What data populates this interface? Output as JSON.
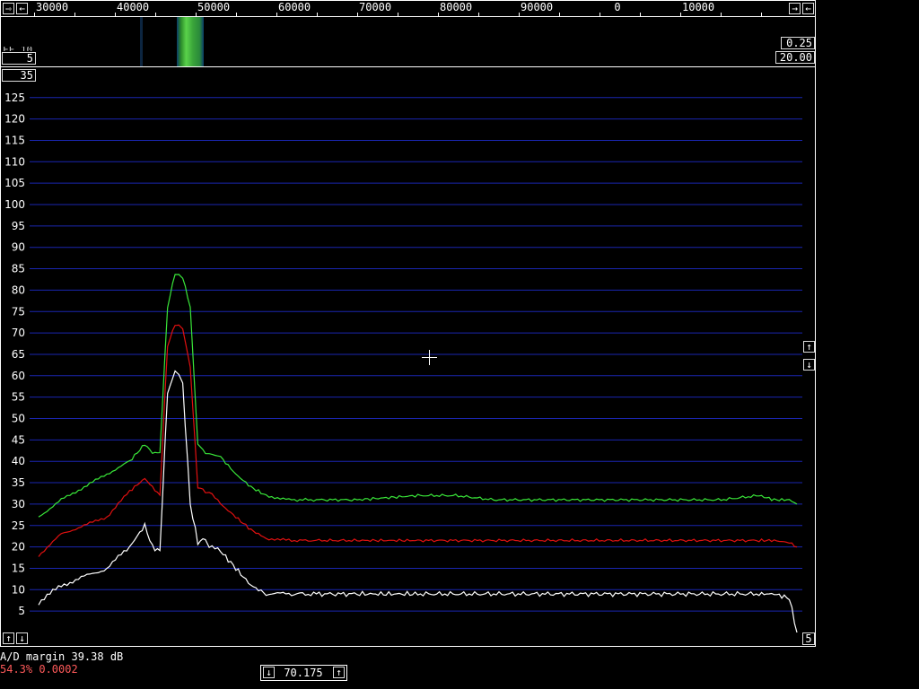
{
  "frequency_scale": {
    "tick_labels": [
      "30000",
      "40000",
      "50000",
      "60000",
      "70000",
      "80000",
      "90000",
      "0",
      "10000"
    ]
  },
  "waterfall": {
    "label_partial": "FF 10",
    "left_box_value": "5",
    "right_top_value": "0.25",
    "right_bottom_value": "20.00"
  },
  "spectrum": {
    "top_left_box_value": "35",
    "bottom_right_box_value": "5",
    "y_tick_labels": [
      "125",
      "120",
      "115",
      "110",
      "105",
      "100",
      "95",
      "90",
      "85",
      "80",
      "75",
      "70",
      "65",
      "60",
      "55",
      "50",
      "45",
      "40",
      "35",
      "30",
      "25",
      "20",
      "15",
      "10",
      "5"
    ]
  },
  "status": {
    "ad_margin_text": "A/D margin 39.38 dB",
    "load_text": "54.3% 0.0002",
    "load_color": "#ff5a5a"
  },
  "freq_control": {
    "value": "70.175"
  },
  "chart_data": {
    "type": "line",
    "ylim": [
      0,
      130
    ],
    "y_ticks": [
      5,
      10,
      15,
      20,
      25,
      30,
      35,
      40,
      45,
      50,
      55,
      60,
      65,
      70,
      75,
      80,
      85,
      90,
      95,
      100,
      105,
      110,
      115,
      120,
      125
    ],
    "x": [
      0,
      3,
      6,
      9,
      12,
      14,
      15,
      16,
      17,
      18,
      18.5,
      19,
      20,
      21,
      22,
      22.5,
      24,
      26,
      28,
      30,
      33,
      37,
      42,
      50,
      55,
      60,
      70,
      80,
      90,
      95,
      97,
      99,
      100
    ],
    "series": [
      {
        "color": "#39e639",
        "values": [
          27,
          31,
          34,
          37,
          40,
          44,
          42,
          42,
          76,
          84,
          84,
          83,
          76,
          44,
          42,
          42,
          41,
          37,
          34,
          32,
          31,
          31,
          31,
          32,
          32,
          31,
          31,
          31,
          31,
          32,
          31,
          31,
          30
        ]
      },
      {
        "color": "#e01010",
        "values": [
          18,
          23,
          25,
          27,
          33,
          36,
          34,
          32,
          67,
          72,
          72,
          71,
          62,
          34,
          33,
          33,
          30,
          27,
          24,
          22,
          21.5,
          21.5,
          21.5,
          21.5,
          21.5,
          21.5,
          21.5,
          21.5,
          21.5,
          21.5,
          21.5,
          21,
          20
        ]
      },
      {
        "color": "#ffffff",
        "values": [
          7,
          11,
          13,
          15,
          20,
          25,
          20,
          19,
          56,
          61,
          60,
          58,
          30,
          21,
          22,
          20,
          19,
          15,
          11,
          9,
          9,
          9,
          9,
          9,
          9,
          9,
          9,
          9,
          9,
          9,
          9,
          8,
          0
        ]
      }
    ]
  }
}
